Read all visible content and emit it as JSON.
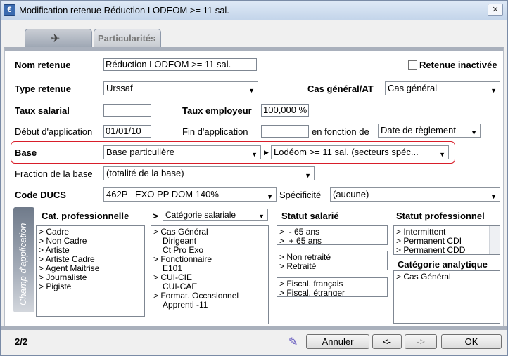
{
  "window": {
    "title": "Modification retenue Réduction LODEOM >= 11 sal.",
    "close_glyph": "✕"
  },
  "tabs": {
    "icon_tab_glyph": "✈",
    "particularites_label": "Particularités"
  },
  "form": {
    "nom_retenue_label": "Nom retenue",
    "nom_retenue_value": "Réduction LODEOM >= 11 sal.",
    "retenue_inactivee_label": "Retenue inactivée",
    "retenue_inactivee_checked": false,
    "type_retenue_label": "Type retenue",
    "type_retenue_value": "Urssaf",
    "cas_general_label": "Cas général/AT",
    "cas_general_value": "Cas général",
    "taux_salarial_label": "Taux salarial",
    "taux_salarial_value": "",
    "taux_employeur_label": "Taux employeur",
    "taux_employeur_value": "100,000 %",
    "debut_label": "Début d'application",
    "debut_value": "01/01/10",
    "fin_label": "Fin d'application",
    "fin_value": "",
    "en_fonction_label": "en fonction de",
    "en_fonction_value": "Date de règlement",
    "base_label": "Base",
    "base_value": "Base particulière",
    "base_detail_value": "Lodéom >= 11 sal. (secteurs spéc...",
    "fraction_label": "Fraction de la base",
    "fraction_value": "(totalité de la base)",
    "code_ducs_label": "Code DUCS",
    "code_ducs_value": "462P   EXO PP DOM 140%",
    "specificite_label": "Spécificité",
    "specificite_value": "(aucune)"
  },
  "champ": {
    "band_label": "Champ d'application",
    "cat_pro_header": "Cat. professionnelle",
    "cat_pro_items": [
      "> Cadre",
      "> Non Cadre",
      "> Artiste",
      "> Artiste Cadre",
      "> Agent Maitrise",
      "> Journaliste",
      "> Pigiste"
    ],
    "cat_sal_prefix": ">",
    "cat_sal_select": "Catégorie salariale",
    "cat_sal_items": [
      {
        "text": "> Cas Général",
        "indent": false
      },
      {
        "text": "Dirigeant",
        "indent": true
      },
      {
        "text": "Ct Pro Exo",
        "indent": true
      },
      {
        "text": "> Fonctionnaire",
        "indent": false
      },
      {
        "text": "E101",
        "indent": true
      },
      {
        "text": "> CUI-CIE",
        "indent": false
      },
      {
        "text": "CUI-CAE",
        "indent": true
      },
      {
        "text": "> Format. Occasionnel",
        "indent": false
      },
      {
        "text": "Apprenti -11",
        "indent": true
      }
    ],
    "statut_salarie_header": "Statut salarié",
    "statut_age_items": [
      ">  - 65 ans",
      ">  + 65 ans"
    ],
    "statut_retraite_items": [
      "> Non retraité",
      "> Retraité"
    ],
    "statut_fiscal_items": [
      "> Fiscal. français",
      "> Fiscal. étranger"
    ],
    "statut_pro_header": "Statut professionnel",
    "statut_pro_items": [
      "> Intermittent",
      "> Permanent CDI",
      "> Permanent CDD"
    ],
    "cat_analytique_header": "Catégorie analytique",
    "cat_analytique_items": [
      "> Cas Général"
    ]
  },
  "footer": {
    "page_indicator": "2/2",
    "annuler_label": "Annuler",
    "prev_label": "<-",
    "next_label": "->",
    "ok_label": "OK"
  }
}
